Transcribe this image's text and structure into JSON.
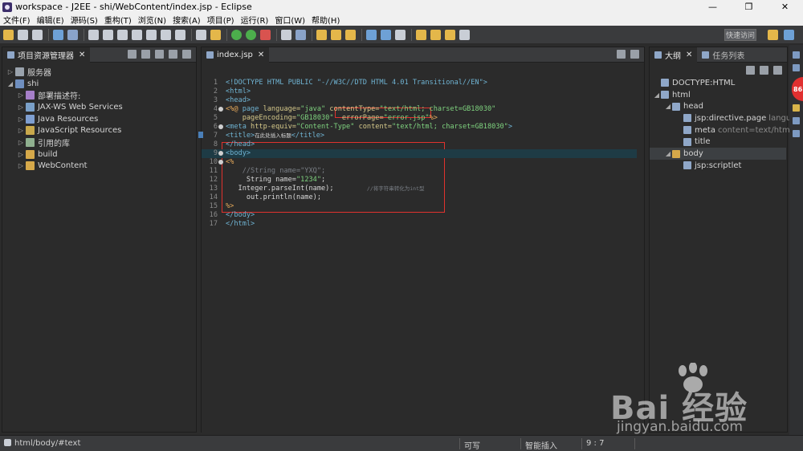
{
  "window": {
    "title": "workspace - J2EE - shi/WebContent/index.jsp - Eclipse",
    "controls": [
      "—",
      "❐",
      "✕"
    ]
  },
  "menubar": [
    "文件(F)",
    "编辑(E)",
    "源码(S)",
    "重构(T)",
    "浏览(N)",
    "搜索(A)",
    "项目(P)",
    "运行(R)",
    "窗口(W)",
    "帮助(H)"
  ],
  "toolbar": {
    "quick_access": "快速访问"
  },
  "project_explorer": {
    "tab_label": "项目资源管理器",
    "close": "✕",
    "items": [
      {
        "label": "服务器",
        "arrow": "▷",
        "icon": "server-folder-icon"
      },
      {
        "label": "shi",
        "arrow": "◢",
        "icon": "web-project-icon"
      },
      {
        "label": "部署描述符:",
        "arrow": "▷",
        "icon": "deployment-descriptor-icon"
      },
      {
        "label": "JAX-WS Web Services",
        "arrow": "▷",
        "icon": "web-services-icon"
      },
      {
        "label": "Java Resources",
        "arrow": "▷",
        "icon": "java-resources-icon"
      },
      {
        "label": "JavaScript Resources",
        "arrow": "▷",
        "icon": "javascript-resources-icon"
      },
      {
        "label": "引用的库",
        "arrow": "▷",
        "icon": "library-icon"
      },
      {
        "label": "build",
        "arrow": "▷",
        "icon": "folder-icon"
      },
      {
        "label": "WebContent",
        "arrow": "▷",
        "icon": "folder-icon"
      }
    ]
  },
  "editor": {
    "tab_label": "index.jsp",
    "close": "✕",
    "lines": [
      {
        "n": "1",
        "parts": [
          [
            "tag",
            "<!DOCTYPE HTML PUBLIC \"-//W3C//DTD HTML 4.01 Transitional//EN\">"
          ]
        ]
      },
      {
        "n": "2",
        "parts": [
          [
            "tag",
            "<html>"
          ]
        ]
      },
      {
        "n": "3",
        "parts": [
          [
            "tag",
            "<head>"
          ]
        ]
      },
      {
        "n": "4",
        "parts": [
          [
            "jsp",
            "<%@ "
          ],
          [
            "tag",
            "page "
          ],
          [
            "attr",
            "language="
          ],
          [
            "val",
            "\"java\" "
          ],
          [
            "attr",
            "contentType="
          ],
          [
            "val",
            "\"text/html; charset=GB18030\""
          ]
        ]
      },
      {
        "n": "5",
        "parts": [
          [
            "plain",
            "    "
          ],
          [
            "attr",
            "pageEncoding="
          ],
          [
            "val",
            "\"GB18030\" "
          ],
          [
            "plain",
            " "
          ],
          [
            "attr",
            "errorPage="
          ],
          [
            "val",
            "\"error.jsp\""
          ],
          [
            "jsp",
            "%>"
          ]
        ]
      },
      {
        "n": "6",
        "parts": [
          [
            "tag",
            "<meta "
          ],
          [
            "attr",
            "http-equiv="
          ],
          [
            "val",
            "\"Content-Type\" "
          ],
          [
            "attr",
            "content="
          ],
          [
            "val",
            "\"text/html; charset=GB18030\""
          ],
          [
            "tag",
            ">"
          ]
        ]
      },
      {
        "n": "7",
        "parts": [
          [
            "tag",
            "<title>"
          ],
          [
            "tiny",
            "在此处插入标题"
          ],
          [
            "tag",
            "</title>"
          ]
        ]
      },
      {
        "n": "8",
        "parts": [
          [
            "tag",
            "</head>"
          ]
        ]
      },
      {
        "n": "9",
        "parts": [
          [
            "tag",
            "<body>"
          ]
        ]
      },
      {
        "n": "10",
        "parts": [
          [
            "jsp",
            "<%"
          ]
        ]
      },
      {
        "n": "11",
        "parts": [
          [
            "plain",
            "    "
          ],
          [
            "cmt",
            "//String name=\"YXQ\";"
          ]
        ]
      },
      {
        "n": "12",
        "parts": [
          [
            "plain",
            "     String name="
          ],
          [
            "val",
            "\"1234\""
          ],
          [
            "plain",
            ";"
          ]
        ]
      },
      {
        "n": "13",
        "parts": [
          [
            "plain",
            "   Integer.parseInt(name);        "
          ],
          [
            "cmt-tiny",
            "//将字符串转化为int型"
          ]
        ]
      },
      {
        "n": "14",
        "parts": [
          [
            "plain",
            "     out.println(name);"
          ]
        ]
      },
      {
        "n": "15",
        "parts": [
          [
            "jsp",
            "%>"
          ]
        ]
      },
      {
        "n": "16",
        "parts": [
          [
            "tag",
            "</body>"
          ]
        ]
      },
      {
        "n": "17",
        "parts": [
          [
            "tag",
            "</html>"
          ]
        ]
      }
    ]
  },
  "outline": {
    "tab_label": "大纲",
    "close": "✕",
    "tab2_label": "任务列表",
    "items": [
      {
        "label": "DOCTYPE:HTML",
        "sub": "",
        "arrow": "",
        "depth": 0
      },
      {
        "label": "html",
        "sub": "",
        "arrow": "◢",
        "depth": 0
      },
      {
        "label": "head",
        "sub": "",
        "arrow": "◢",
        "depth": 1
      },
      {
        "label": "jsp:directive.page",
        "sub": "language",
        "arrow": "",
        "depth": 2
      },
      {
        "label": "meta",
        "sub": "content=text/html; c",
        "arrow": "",
        "depth": 2
      },
      {
        "label": "title",
        "sub": "",
        "arrow": "",
        "depth": 2
      },
      {
        "label": "body",
        "sub": "",
        "arrow": "◢",
        "depth": 1
      },
      {
        "label": "jsp:scriptlet",
        "sub": "",
        "arrow": "",
        "depth": 2
      }
    ]
  },
  "badge": {
    "text": "86"
  },
  "statusbar": {
    "path": "html/body/#text",
    "writable": "可写",
    "insert_mode": "智能插入",
    "position": "9 : 7"
  },
  "watermark": {
    "brand": "Bai 经验",
    "url": "jingyan.baidu.com"
  },
  "colors": {
    "background": "#2b2b2b",
    "annotation_red": "#e0322e",
    "current_line": "#1e3b45"
  }
}
